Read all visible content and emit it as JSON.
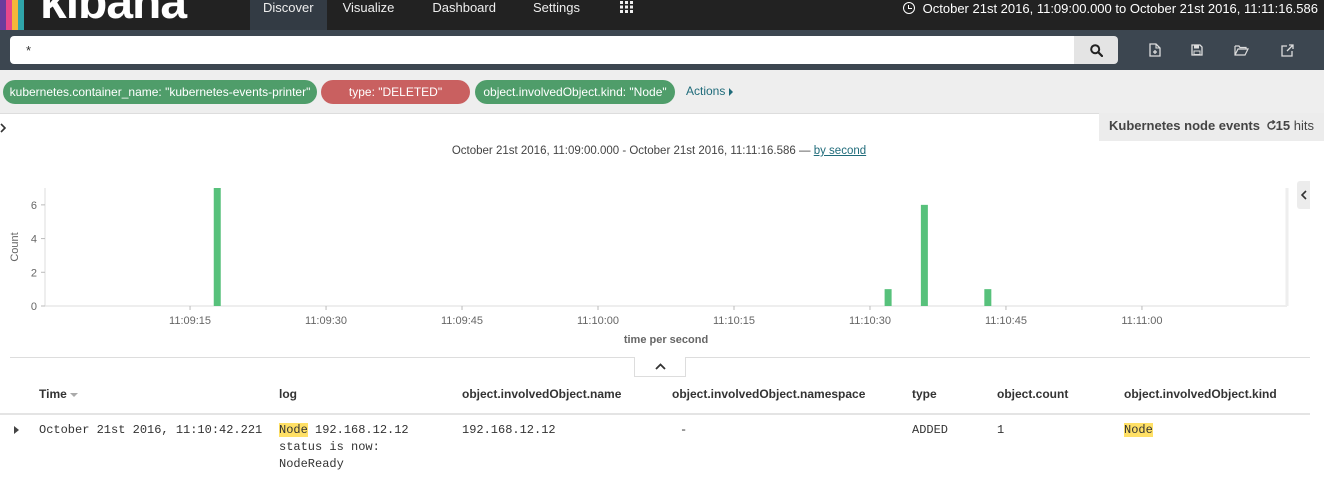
{
  "app": {
    "logo_text": "kibana",
    "logo_colors": [
      "#6a3c9c",
      "#e8478b",
      "#f4b73a",
      "#2fa4a9"
    ]
  },
  "nav": {
    "items": [
      "Discover",
      "Visualize",
      "Dashboard",
      "Settings"
    ],
    "active": "Discover",
    "apps_icon": "grid-icon"
  },
  "timepicker": {
    "range_label": "October 21st 2016, 11:09:00.000 to October 21st 2016, 11:11:16.586",
    "icon": "clock-icon"
  },
  "search": {
    "query": "*",
    "button_icon": "search-icon"
  },
  "toolbar": {
    "icons": [
      "new-document-icon",
      "save-icon",
      "open-folder-icon",
      "share-icon"
    ]
  },
  "filters": [
    {
      "label": "kubernetes.container_name: \"kubernetes-events-printer\"",
      "color": "#4f9d6a"
    },
    {
      "label": "type: \"DELETED\"",
      "color": "#c96060"
    },
    {
      "label": "object.involvedObject.kind: \"Node\"",
      "color": "#4f9d6a"
    }
  ],
  "filter_actions": "Actions",
  "saved_search": {
    "name": "Kubernetes node events",
    "hits_count": "15",
    "hits_label": "hits"
  },
  "histogram": {
    "range_text": "October 21st 2016, 11:09:00.000 - October 21st 2016, 11:11:16.586 —",
    "interval_link": "by second"
  },
  "chart_data": {
    "type": "bar",
    "bar_color": "#57c17b",
    "ylabel": "Count",
    "xlabel": "time per second",
    "ylim": [
      0,
      7
    ],
    "yticks": [
      0,
      2,
      4,
      6
    ],
    "xlim_seconds": [
      -1,
      136
    ],
    "xticks": [
      {
        "t": 15,
        "label": "11:09:15"
      },
      {
        "t": 30,
        "label": "11:09:30"
      },
      {
        "t": 45,
        "label": "11:09:45"
      },
      {
        "t": 60,
        "label": "11:10:00"
      },
      {
        "t": 75,
        "label": "11:10:15"
      },
      {
        "t": 90,
        "label": "11:10:30"
      },
      {
        "t": 105,
        "label": "11:10:45"
      },
      {
        "t": 120,
        "label": "11:11:00"
      }
    ],
    "bars": [
      {
        "t": 18,
        "value": 7
      },
      {
        "t": 92,
        "value": 1
      },
      {
        "t": 96,
        "value": 6
      },
      {
        "t": 103,
        "value": 1
      }
    ]
  },
  "table": {
    "columns": [
      "Time",
      "log",
      "object.involvedObject.name",
      "object.involvedObject.namespace",
      "type",
      "object.count",
      "object.involvedObject.kind"
    ],
    "rows": [
      {
        "time": "October 21st 2016, 11:10:42.221",
        "log_highlight": "Node",
        "log_line1": " 192.168.12.12",
        "log_line2": "status is now:",
        "log_line3": "NodeReady",
        "name": "192.168.12.12",
        "namespace": "-",
        "type": "ADDED",
        "count": "1",
        "kind": "Node"
      }
    ]
  }
}
